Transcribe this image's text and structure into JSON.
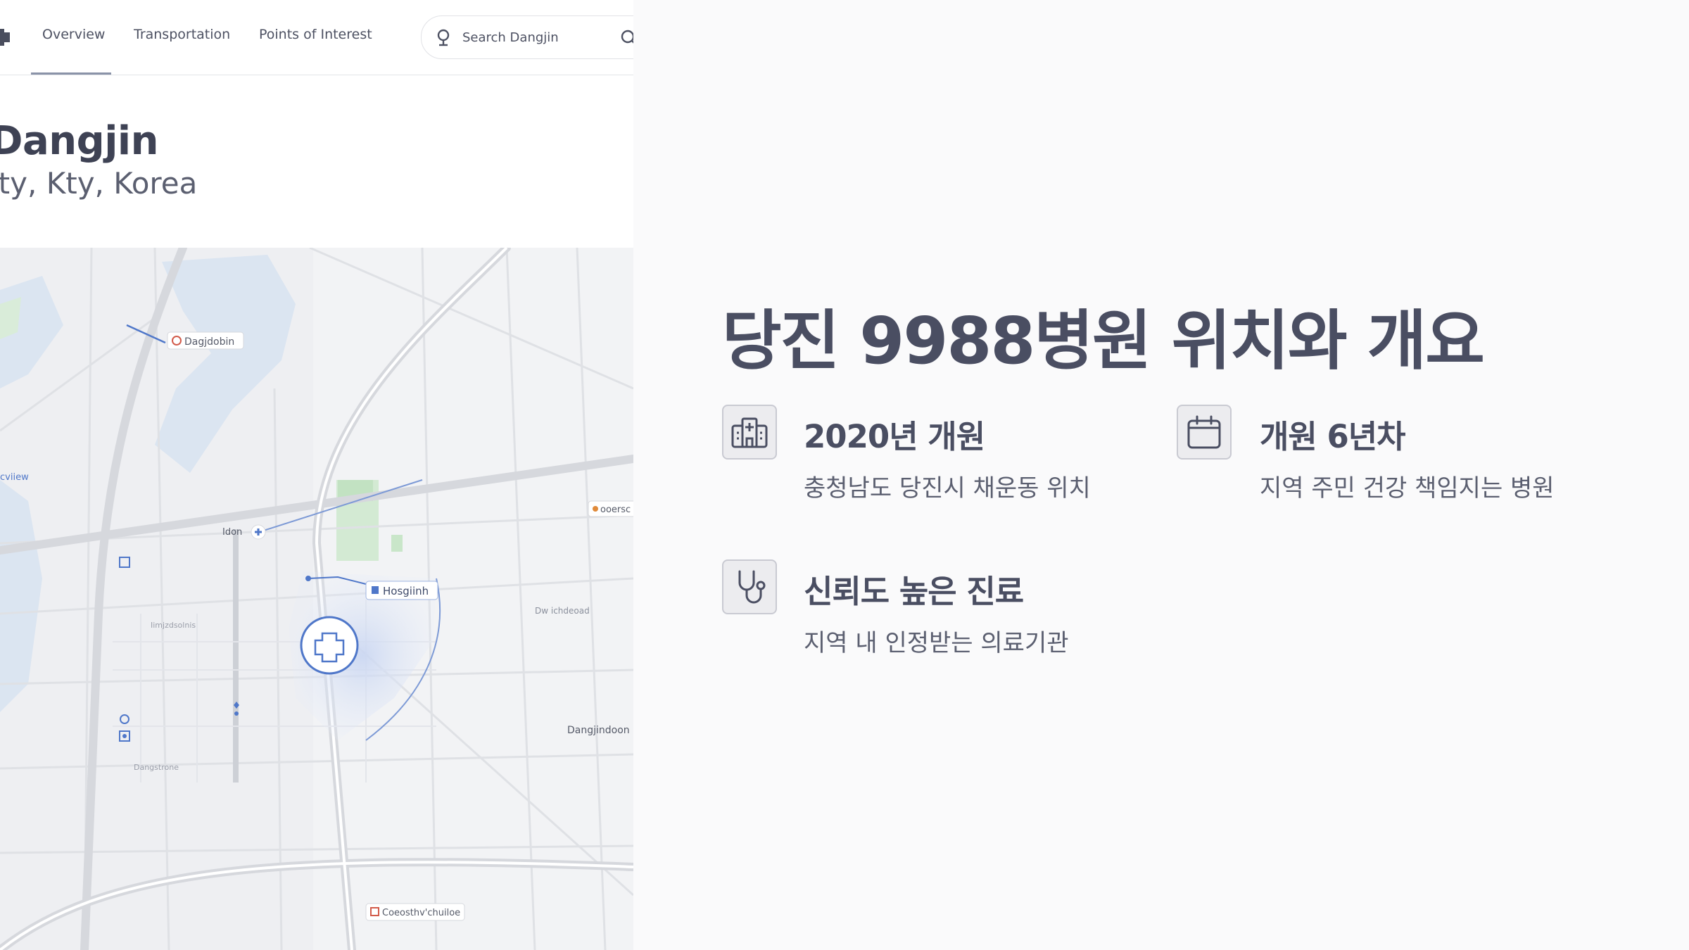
{
  "nav": {
    "items": [
      "Overview",
      "Transportation",
      "Points of Interest"
    ],
    "active_index": 0,
    "search_placeholder": "Search Dangjin"
  },
  "place": {
    "title": "Dangjin",
    "subtitle": "ity, Kty, Korea"
  },
  "map": {
    "labels": {
      "north": "Dagjdobin",
      "west": "cviiew",
      "center_left": "Idon",
      "hospital": "Hosgiinh",
      "east": "ooersc",
      "road": "Dw ichdeoad",
      "south_east": "Dangjindoon",
      "south": "Coeosthv'chuiloe",
      "street_a": "Iimjzdsolnis",
      "street_b": "Dangstrone"
    },
    "colors": {
      "water": "#dbe5f1",
      "park": "#d3ead3",
      "highlight": "#4f77c9",
      "road": "#d6d8dd"
    }
  },
  "heading": "당진 9988병원 위치와 개요",
  "features": [
    {
      "icon": "hospital-icon",
      "title": "2020년 개원",
      "desc": "충청남도 당진시 채운동 위치"
    },
    {
      "icon": "calendar-icon",
      "title": "개원 6년차",
      "desc": "지역 주민 건강 책임지는 병원"
    },
    {
      "icon": "stethoscope-icon",
      "title": "신뢰도 높은 진료",
      "desc": "지역 내 인정받는 의료기관"
    }
  ]
}
